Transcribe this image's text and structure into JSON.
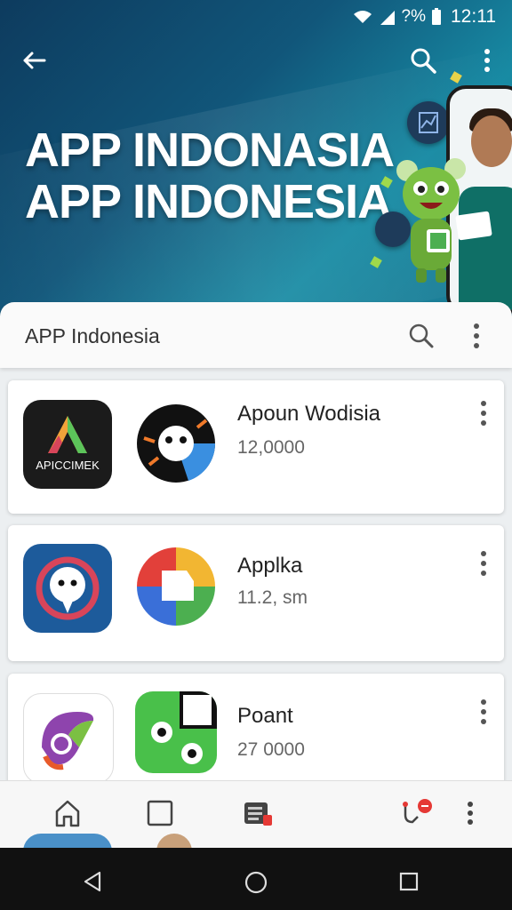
{
  "status": {
    "battery": "?%",
    "time": "12:11"
  },
  "banner": {
    "line1": "APP INDONASIA",
    "line2": "APP INDONESIA"
  },
  "subbar": {
    "title": "APP Indonesia"
  },
  "apps": [
    {
      "icon_text": "APICCIMEK",
      "name": "Apoun Wodisia",
      "count": "12,0000"
    },
    {
      "name": "Applka",
      "count": "11.2, sm"
    },
    {
      "name": "Poant",
      "count": "27 0000"
    }
  ],
  "icons": {
    "back": "arrow-left-icon",
    "search": "search-icon",
    "more": "more-vert-icon",
    "home": "home-icon",
    "square": "square-icon",
    "news": "newspaper-icon",
    "tool": "pin-tool-icon"
  },
  "colors": {
    "banner": "#11567a",
    "accent_green": "#4caf50"
  }
}
